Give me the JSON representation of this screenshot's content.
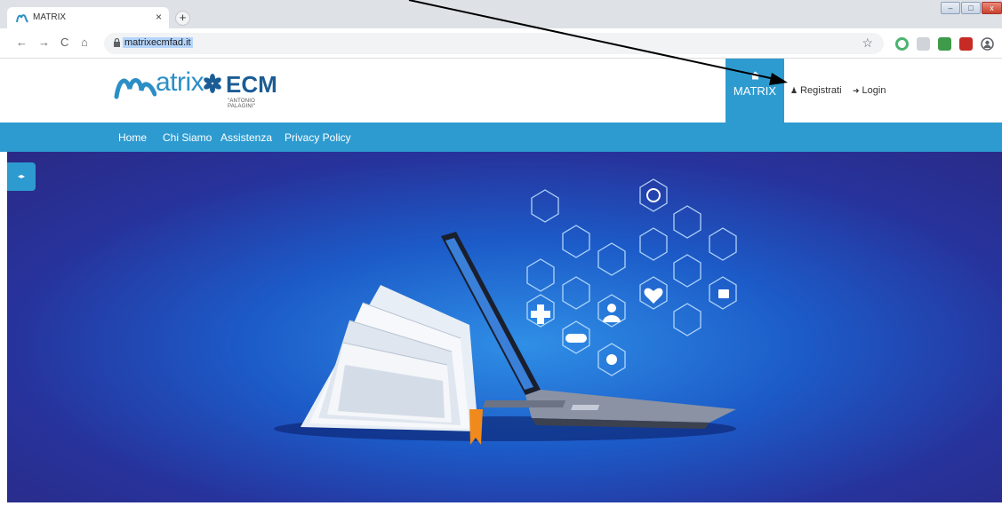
{
  "browser": {
    "tab_title": "MATRIX",
    "tab_close": "×",
    "new_tab": "+",
    "url": "matrixecmfad.it",
    "nav": {
      "back": "←",
      "forward": "→",
      "reload": "C",
      "home": "⌂"
    },
    "bookmark_star": "☆",
    "window_controls": {
      "minimize": "–",
      "maximize": "□",
      "close": "x"
    },
    "extension_icons": [
      "chrome-extension-icon",
      "download-icon",
      "translate-extension-icon",
      "pdf-extension-icon",
      "profile-icon"
    ],
    "profile_glyph": "⊖"
  },
  "site": {
    "logo": {
      "text": "atrix",
      "ecm": "ECM",
      "subtitle": "\"ANTONIO PALAGINI\""
    },
    "matrix_tab_label": "MATRIX",
    "register_label": "Registrati",
    "login_label": "Login",
    "nav_items": [
      "Home",
      "Chi Siamo",
      "Assistenza",
      "Privacy Policy"
    ],
    "sidebar_toggle": "◂▸",
    "colors": {
      "brand_blue": "#2e9bd0",
      "logo_dark": "#1b5c95",
      "hero_dark": "#27339c"
    }
  }
}
